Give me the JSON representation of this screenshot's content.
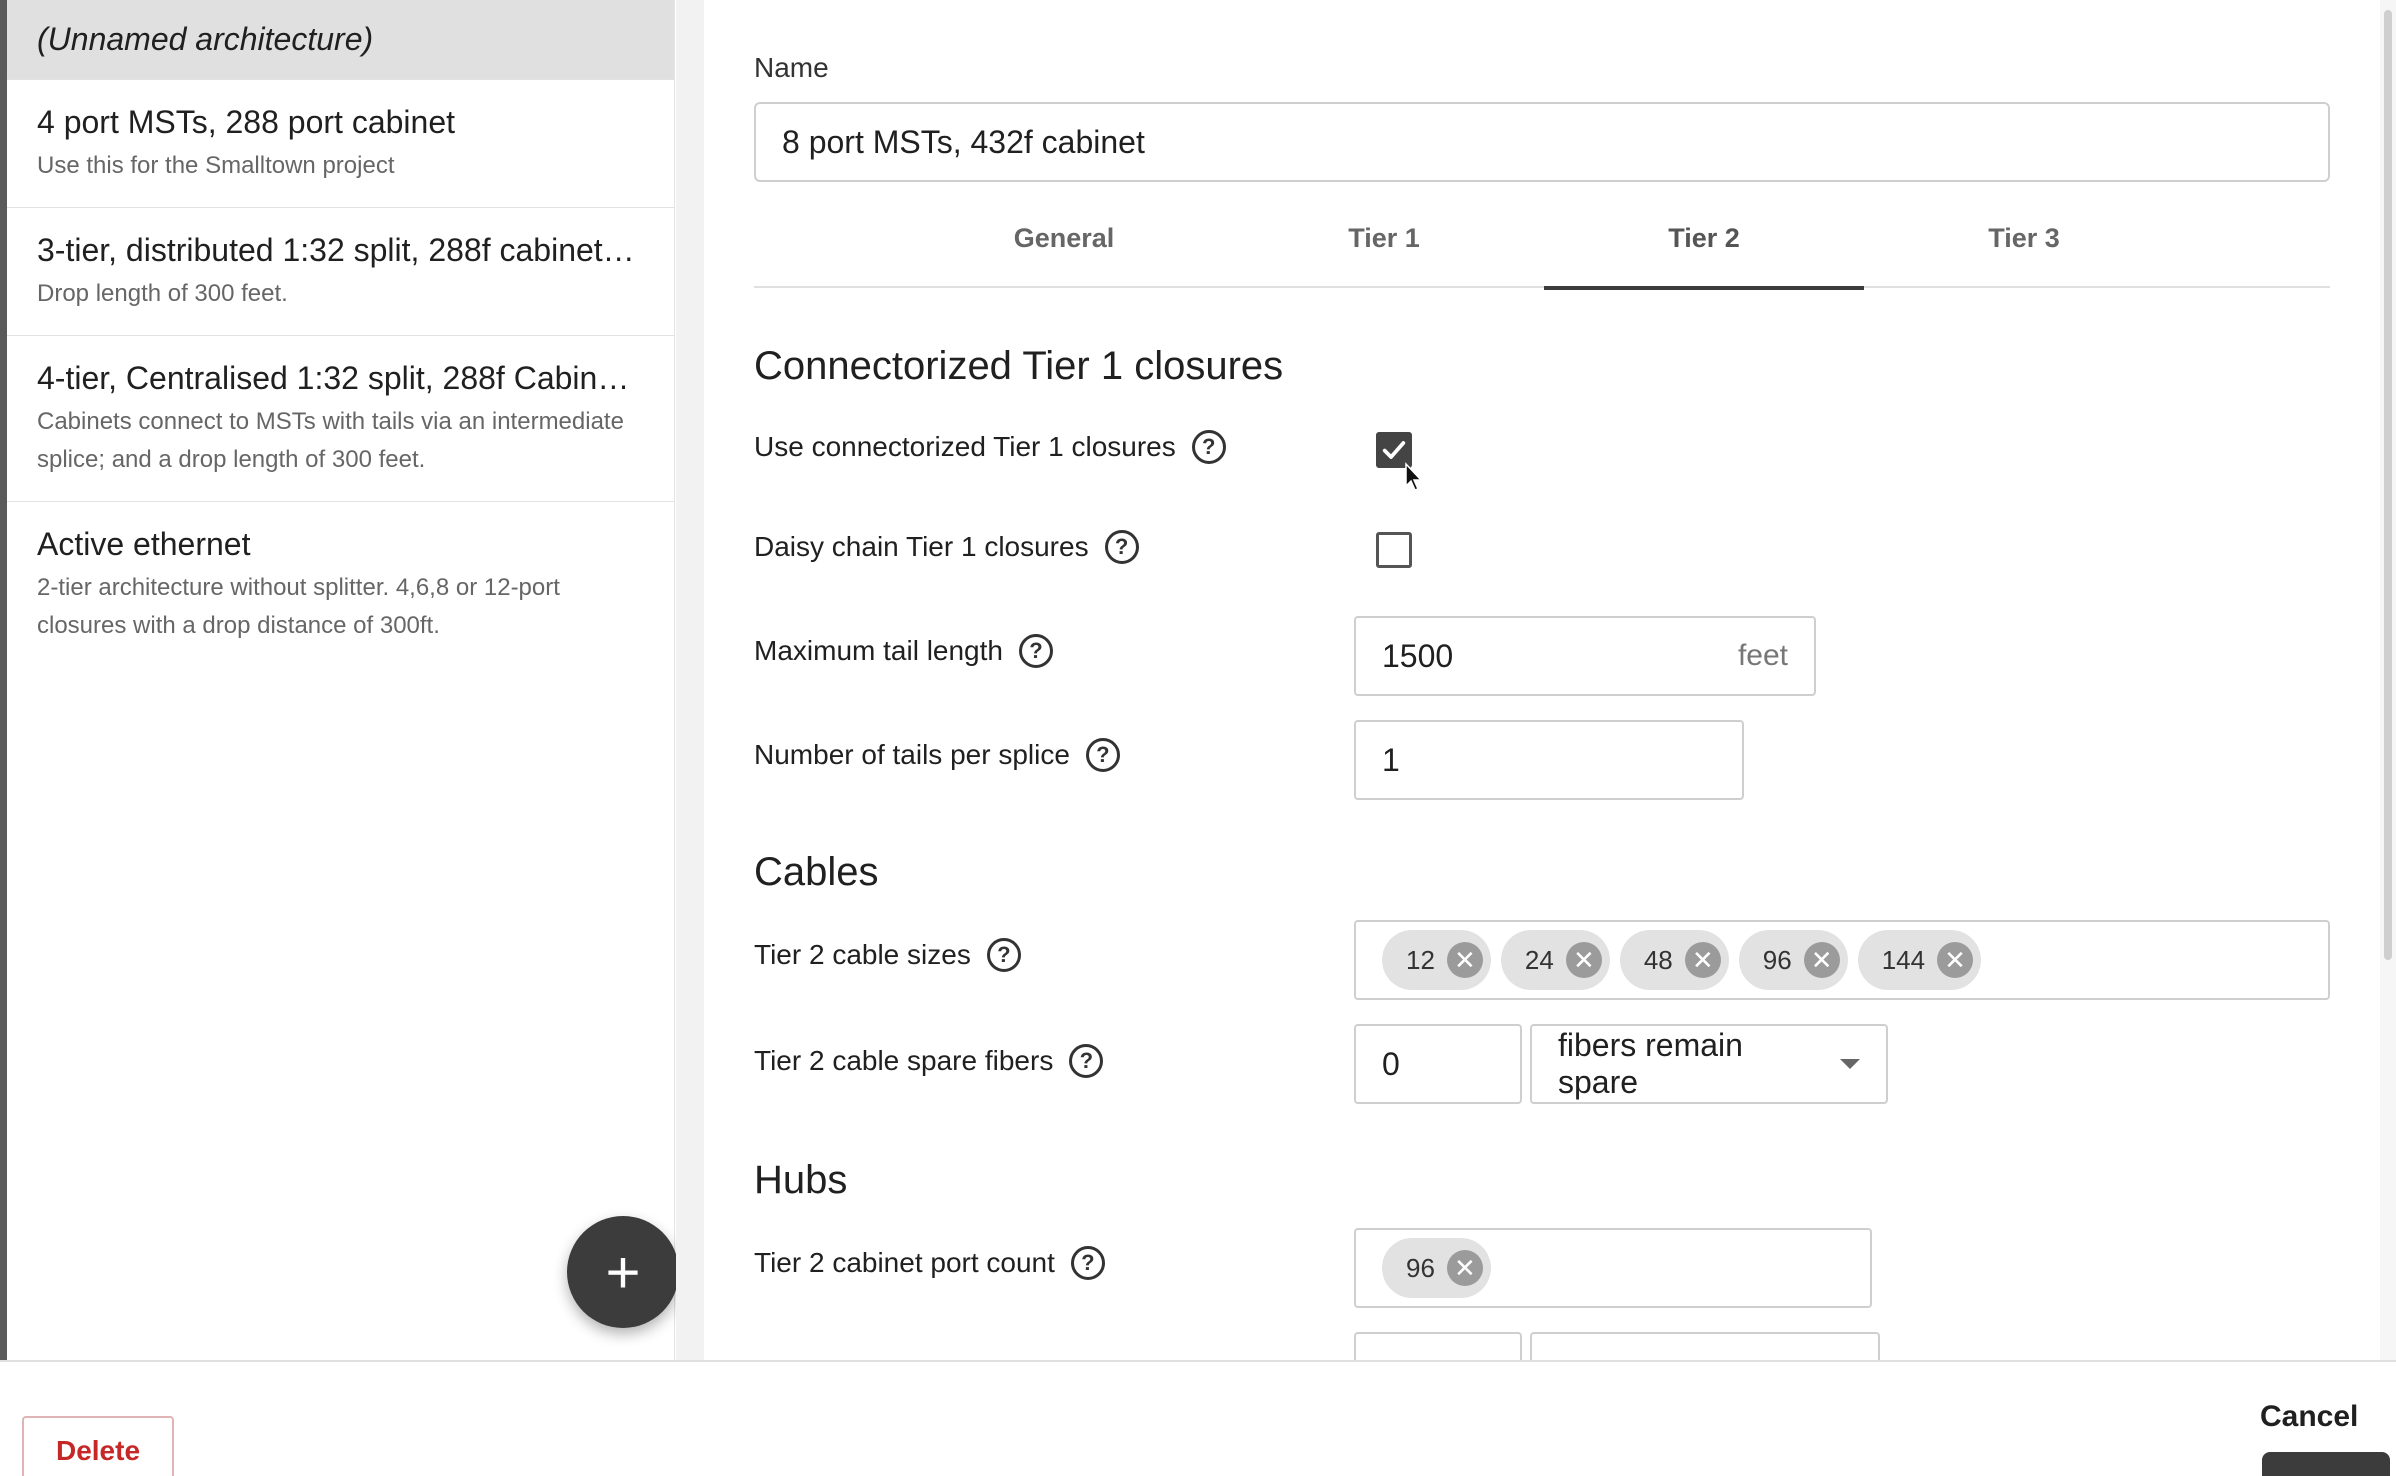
{
  "sidebar": {
    "items": [
      {
        "title": "(Unnamed architecture)",
        "desc": ""
      },
      {
        "title": "4 port MSTs, 288 port cabinet",
        "desc": "Use this for the Smalltown project"
      },
      {
        "title": "3-tier, distributed 1:32 split, 288f cabinet…",
        "desc": "Drop length of 300 feet."
      },
      {
        "title": "4-tier, Centralised 1:32 split, 288f Cabine…",
        "desc": "Cabinets connect to MSTs with tails via an intermediate splice; and a drop length of 300 feet."
      },
      {
        "title": "Active ethernet",
        "desc": "2-tier architecture without splitter. 4,6,8 or 12-port closures with a drop distance of 300ft."
      }
    ],
    "add_symbol": "+"
  },
  "form": {
    "name_label": "Name",
    "name_value": "8 port MSTs, 432f cabinet",
    "tabs": [
      "General",
      "Tier 1",
      "Tier 2",
      "Tier 3"
    ],
    "active_tab": "Tier 2",
    "sections": {
      "connectorized": "Connectorized Tier 1 closures",
      "cables": "Cables",
      "hubs": "Hubs"
    },
    "use_connectorized_label": "Use connectorized Tier 1 closures",
    "use_connectorized_checked": true,
    "daisy_chain_label": "Daisy chain Tier 1 closures",
    "daisy_chain_checked": false,
    "max_tail_label": "Maximum tail length",
    "max_tail_value": "1500",
    "max_tail_unit": "feet",
    "tails_per_splice_label": "Number of tails per splice",
    "tails_per_splice_value": "1",
    "cable_sizes_label": "Tier 2 cable sizes",
    "cable_sizes": [
      "12",
      "24",
      "48",
      "96",
      "144"
    ],
    "spare_fibers_label": "Tier 2 cable spare fibers",
    "spare_fibers_value": "0",
    "spare_fibers_mode": "fibers remain spare",
    "cabinet_port_label": "Tier 2 cabinet port count",
    "cabinet_ports": [
      "96"
    ],
    "help_symbol": "?",
    "chip_remove_symbol": "✕"
  },
  "footer": {
    "delete_label": "Delete",
    "cancel_label": "Cancel"
  }
}
